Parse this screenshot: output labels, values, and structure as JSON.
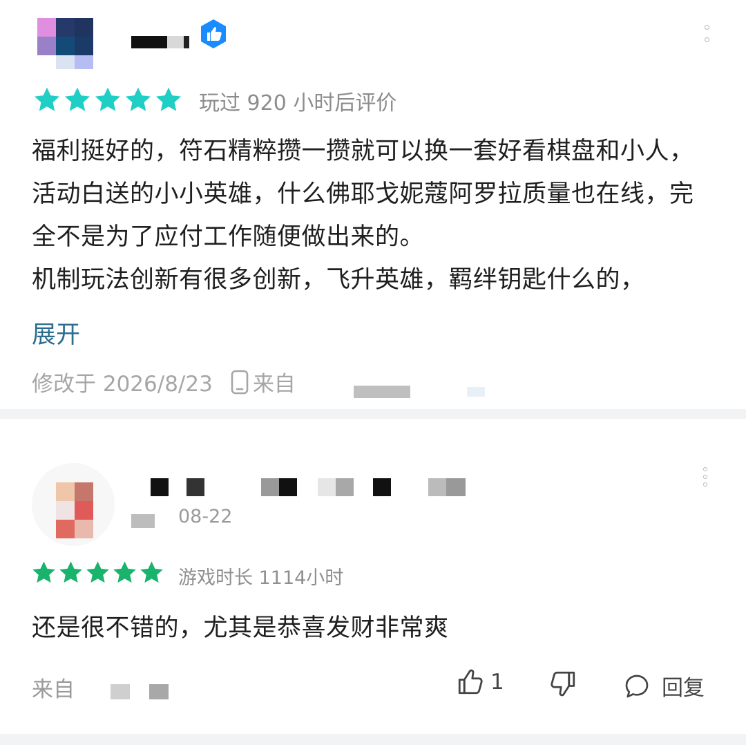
{
  "reviews": [
    {
      "rating_stars": 5,
      "star_color": "#1fcfc5",
      "play_time": "玩过 920 小时后评价",
      "body_paragraphs": [
        "福利挺好的，符石精粹攒一攒就可以换一套好看棋盘和小人，活动白送的小小英雄，什么佛耶戈妮蔻阿罗拉质量也在线，完全不是为了应付工作随便做出来的。",
        "机制玩法创新有很多创新，飞升英雄，羁绊钥匙什么的，"
      ],
      "expand_label": "展开",
      "modified_label": "修改于 2026/8/23",
      "source_label": "来自",
      "badge_icon": "thumbs-up-badge-icon",
      "badge_color": "#1a8cff"
    },
    {
      "rating_stars": 5,
      "star_color": "#19b36b",
      "date": "08-22",
      "play_time": "游戏时长  1114小时",
      "body": "还是很不错的，尤其是恭喜发财非常爽",
      "source_label": "来自",
      "like_count": "1",
      "reply_label": "回复"
    }
  ]
}
